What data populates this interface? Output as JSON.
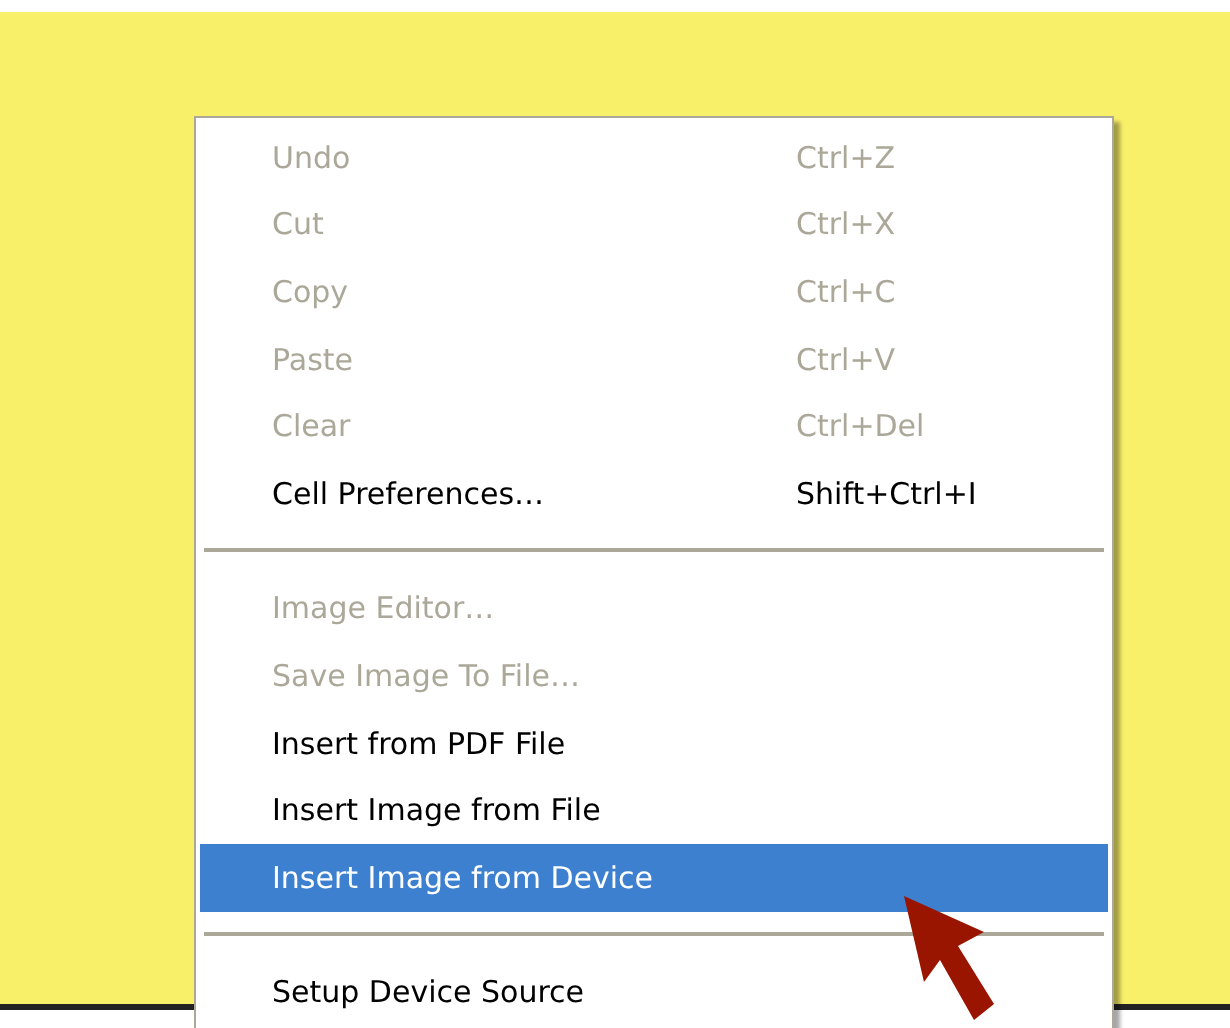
{
  "context_menu": {
    "items": [
      {
        "kind": "item",
        "label": "Undo",
        "shortcut": "Ctrl+Z",
        "disabled": true,
        "selected": false
      },
      {
        "kind": "item",
        "label": "Cut",
        "shortcut": "Ctrl+X",
        "disabled": true,
        "selected": false
      },
      {
        "kind": "item",
        "label": "Copy",
        "shortcut": "Ctrl+C",
        "disabled": true,
        "selected": false
      },
      {
        "kind": "item",
        "label": "Paste",
        "shortcut": "Ctrl+V",
        "disabled": true,
        "selected": false
      },
      {
        "kind": "item",
        "label": "Clear",
        "shortcut": "Ctrl+Del",
        "disabled": true,
        "selected": false
      },
      {
        "kind": "item",
        "label": "Cell Preferences…",
        "shortcut": "Shift+Ctrl+I",
        "disabled": false,
        "selected": false
      },
      {
        "kind": "separator"
      },
      {
        "kind": "item",
        "label": "Image Editor…",
        "disabled": true,
        "selected": false
      },
      {
        "kind": "item",
        "label": "Save Image To File…",
        "disabled": true,
        "selected": false
      },
      {
        "kind": "item",
        "label": "Insert from PDF File",
        "disabled": false,
        "selected": false
      },
      {
        "kind": "item",
        "label": "Insert Image from File",
        "disabled": false,
        "selected": false
      },
      {
        "kind": "item",
        "label": "Insert Image from Device",
        "disabled": false,
        "selected": true
      },
      {
        "kind": "separator"
      },
      {
        "kind": "item",
        "label": "Setup Device Source",
        "disabled": false,
        "selected": false
      }
    ]
  }
}
